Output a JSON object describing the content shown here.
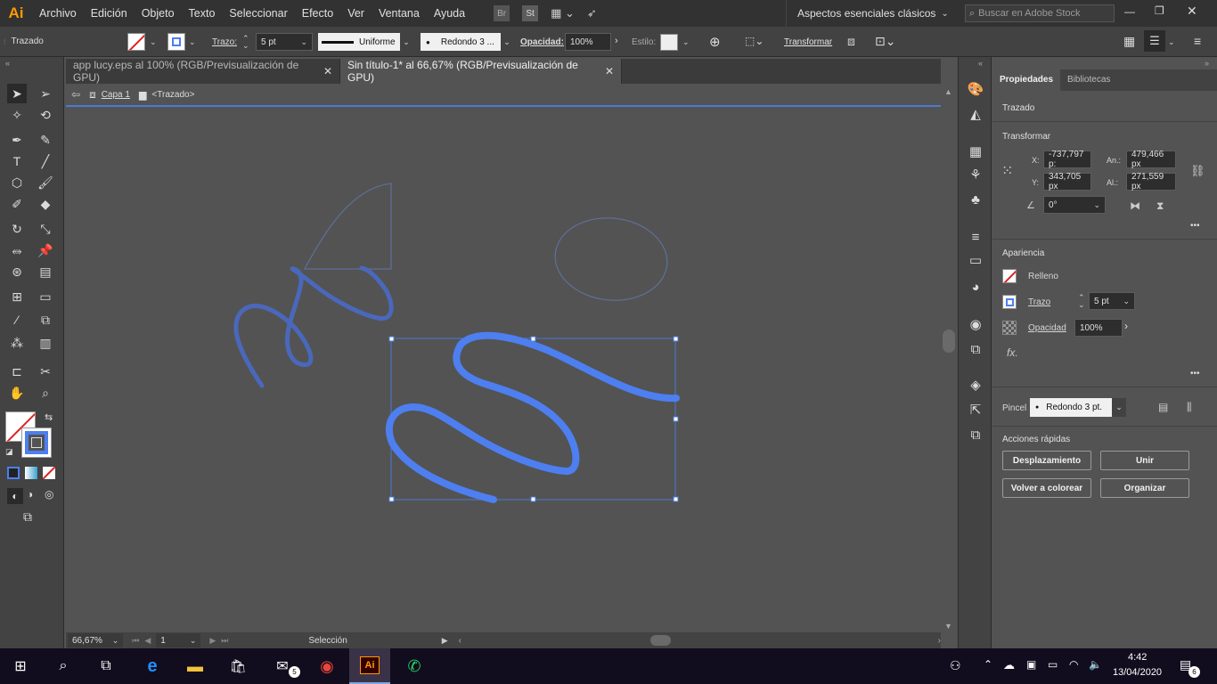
{
  "menubar": {
    "logo": "Ai",
    "items": [
      "Archivo",
      "Edición",
      "Objeto",
      "Texto",
      "Seleccionar",
      "Efecto",
      "Ver",
      "Ventana",
      "Ayuda"
    ],
    "br_label": "Br",
    "st_label": "St",
    "workspace": "Aspectos esenciales clásicos",
    "search_placeholder": "Buscar en Adobe Stock"
  },
  "control": {
    "object_type": "Trazado",
    "stroke_label": "Trazo:",
    "stroke_weight": "5 pt",
    "profile": "Uniforme",
    "brush": "Redondo 3 ...",
    "opacity_label": "Opacidad:",
    "opacity_value": "100%",
    "style_label": "Estilo:",
    "transform_label": "Transformar"
  },
  "tabs": [
    {
      "label": "app lucy.eps al 100% (RGB/Previsualización de GPU)",
      "close": "✕"
    },
    {
      "label": "Sin título-1* al 66,67% (RGB/Previsualización de GPU)",
      "close": "✕"
    }
  ],
  "breadcrumb": {
    "layer": "Capa 1",
    "object": "<Trazado>"
  },
  "properties": {
    "tab_props": "Propiedades",
    "tab_libs": "Bibliotecas",
    "object_type": "Trazado",
    "transform_title": "Transformar",
    "x_label": "X:",
    "x_value": "-737,797 p:",
    "y_label": "Y:",
    "y_value": "343,705 px",
    "w_label": "An.:",
    "w_value": "479,466 px",
    "h_label": "Al.:",
    "h_value": "271,559 px",
    "angle_value": "0°",
    "appearance_title": "Apariencia",
    "fill_label": "Relleno",
    "stroke_label": "Trazo",
    "stroke_value": "5 pt",
    "opacity_label": "Opacidad",
    "opacity_value": "100%",
    "fx_label": "fx.",
    "brush_label": "Pincel",
    "brush_value": "Redondo 3 pt.",
    "quick_title": "Acciones rápidas",
    "btn_offset": "Desplazamiento",
    "btn_unite": "Unir",
    "btn_recolor": "Volver a colorear",
    "btn_arrange": "Organizar",
    "more": "•••"
  },
  "status": {
    "zoom": "66,67%",
    "artboard": "1",
    "tool": "Selección"
  },
  "taskbar": {
    "mail_badge": "5",
    "time": "4:42",
    "date": "13/04/2020",
    "notif_badge": "6",
    "ai_label": "Ai"
  },
  "colors": {
    "stroke_blue": "#4d7ff0",
    "selection_blue": "#4a7ad6",
    "ai_orange": "#ff9a00"
  }
}
